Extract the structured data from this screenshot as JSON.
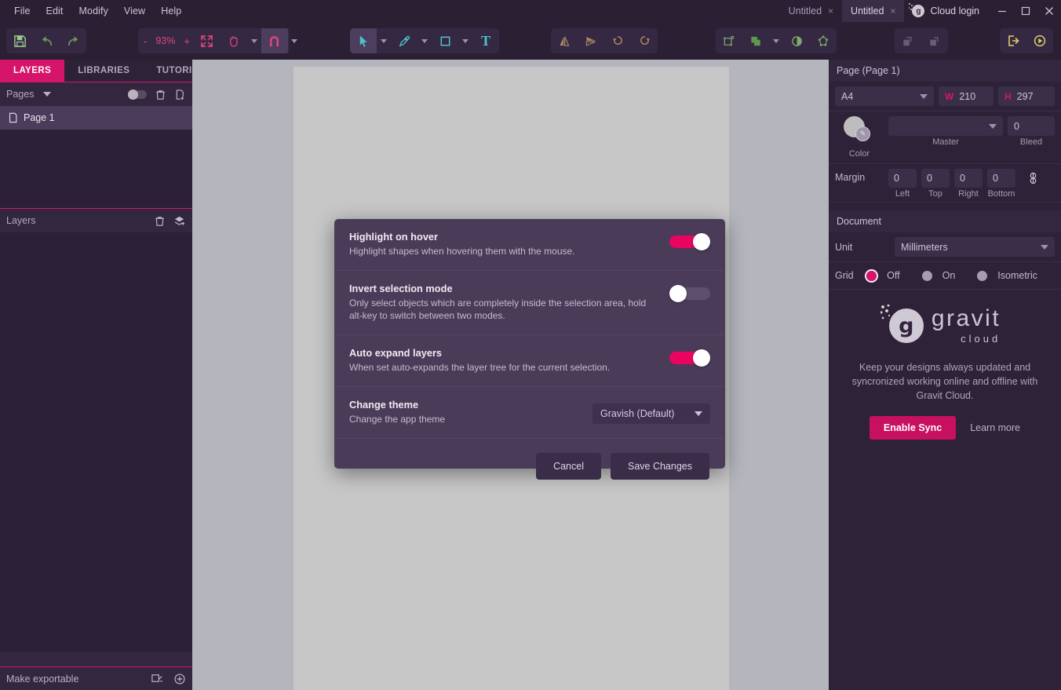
{
  "app": {
    "menus": [
      "File",
      "Edit",
      "Modify",
      "View",
      "Help"
    ],
    "tabs": [
      {
        "label": "Untitled",
        "close": "×",
        "active": false
      },
      {
        "label": "Untitled",
        "close": "×",
        "active": true
      }
    ],
    "cloud_login": "Cloud login",
    "cloud_badge": "g",
    "window_controls": {
      "minimize": "─",
      "maximize": "☐",
      "close": "✕"
    }
  },
  "toolbar": {
    "save_icon": "save-icon",
    "undo_icon": "undo-icon",
    "redo_icon": "redo-icon",
    "zoom_minus": "-",
    "zoom_value": "93%",
    "zoom_plus": "+",
    "fit_icon": "fit-to-screen-icon",
    "hand_icon": "hand-tool-icon",
    "snap_icon": "magnet-snap-icon",
    "pointer_icon": "pointer-tool-icon",
    "pen_icon": "pen-tool-icon",
    "rect_icon": "rectangle-tool-icon",
    "text_icon": "T",
    "flip_h_icon": "flip-horizontal-icon",
    "flip_v_icon": "flip-vertical-icon",
    "rotate_ccw_icon": "rotate-counterclockwise-icon",
    "rotate_cw_icon": "rotate-clockwise-icon",
    "transform_icon": "transform-icon",
    "boolean_icon": "boolean-ops-icon",
    "contrast_icon": "contrast-icon",
    "nodes_icon": "edit-nodes-icon",
    "dup1_icon": "duplicate-front-icon",
    "dup2_icon": "duplicate-back-icon",
    "export_icon": "export-icon",
    "preview_icon": "preview-play-icon"
  },
  "left_panel": {
    "tabs": [
      {
        "label": "LAYERS",
        "active": true
      },
      {
        "label": "LIBRARIES",
        "active": false
      },
      {
        "label": "TUTORIALS",
        "active": false
      }
    ],
    "pages_section": {
      "title": "Pages",
      "toggle_icon": "visibility-toggle",
      "delete_icon": "trash-icon",
      "add_icon": "add-page-icon",
      "items": [
        {
          "label": "Page 1",
          "icon": "page-icon"
        }
      ]
    },
    "layers_section": {
      "title": "Layers",
      "delete_icon": "trash-icon",
      "add_icon": "add-layer-icon"
    },
    "footer": {
      "label": "Make exportable",
      "slice_icon": "slice-icon",
      "add_icon": "add-export-icon"
    }
  },
  "right_panel": {
    "page_header": "Page (Page 1)",
    "preset": "A4",
    "width_label": "W",
    "width_value": "210",
    "height_label": "H",
    "height_value": "297",
    "color_label": "Color",
    "master_value": "",
    "master_label": "Master",
    "bleed_value": "0",
    "bleed_label": "Bleed",
    "margin_label": "Margin",
    "margins": [
      {
        "value": "0",
        "label": "Left"
      },
      {
        "value": "0",
        "label": "Top"
      },
      {
        "value": "0",
        "label": "Right"
      },
      {
        "value": "0",
        "label": "Bottom"
      }
    ],
    "margin_link_icon": "link-margins-icon",
    "document_header": "Document",
    "unit_label": "Unit",
    "unit_value": "Millimeters",
    "grid_label": "Grid",
    "grid_options": [
      {
        "label": "Off",
        "selected": true
      },
      {
        "label": "On",
        "selected": false
      },
      {
        "label": "Isometric",
        "selected": false
      }
    ],
    "cloud": {
      "logo_main": "gravit",
      "logo_sub": "cloud",
      "logo_letter": "g",
      "description": "Keep your designs always updated and syncronized working online and offline with Gravit Cloud.",
      "enable_button": "Enable Sync",
      "learn_link": "Learn more"
    }
  },
  "modal": {
    "options": [
      {
        "title": "Highlight on hover",
        "desc": "Highlight shapes when hovering them with the mouse.",
        "control": "toggle",
        "state": "on"
      },
      {
        "title": "Invert selection mode",
        "desc": "Only select objects which are completely inside the selection area, hold alt-key to switch between two modes.",
        "control": "toggle",
        "state": "off"
      },
      {
        "title": "Auto expand layers",
        "desc": "When set auto-expands the layer tree for the current selection.",
        "control": "toggle",
        "state": "on"
      },
      {
        "title": "Change theme",
        "desc": "Change the app theme",
        "control": "select",
        "value": "Gravish (Default)"
      }
    ],
    "cancel_label": "Cancel",
    "save_label": "Save Changes"
  },
  "colors": {
    "accent_pink": "#d6156a",
    "toggle_on": "#e8045f",
    "panel_bg": "#332641",
    "canvas_bg": "#b4b5bd",
    "modal_bg": "#4a3b58"
  }
}
